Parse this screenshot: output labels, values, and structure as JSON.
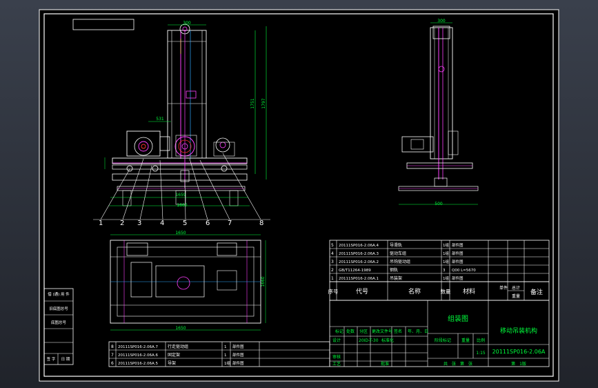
{
  "drawing": {
    "dims": {
      "top_width": "300",
      "height_total": "1751",
      "height_outer": "1797",
      "motor_offset": "531",
      "width_front": "1659",
      "base_width": "1660",
      "side_top": "300",
      "side_base": "500",
      "plan_width": "1650",
      "plan_depth": "1660",
      "plan_bottom": "1650"
    },
    "balloons": [
      "1",
      "2",
      "3",
      "4",
      "5",
      "6",
      "7",
      "8"
    ],
    "parts_upper": [
      {
        "no": "5",
        "code": "20111SP016-2.06A.4",
        "name": "导滑轨",
        "qty": "1组",
        "mat": "部件图"
      },
      {
        "no": "4",
        "code": "20111SP016-2.06A.3",
        "name": "驱动车组",
        "qty": "1组",
        "mat": "部件图"
      },
      {
        "no": "3",
        "code": "20111SP016-2.06A.2",
        "name": "吊钩驱动组",
        "qty": "1组",
        "mat": "部件图"
      },
      {
        "no": "2",
        "code": "GB/T11264-1989",
        "name": "钢轨",
        "qty": "3",
        "mat": "Q00 L=5670"
      },
      {
        "no": "1",
        "code": "20111SP016-2.06A.1",
        "name": "吊装架",
        "qty": "1组",
        "mat": "部件图"
      }
    ],
    "parts_lower": [
      {
        "no": "8",
        "code": "20111SP016-2.06A.7",
        "name": "行走驱动组",
        "qty": "1",
        "mat": "部件图"
      },
      {
        "no": "7",
        "code": "20111SP016-2.06A.6",
        "name": "固定架",
        "qty": "1",
        "mat": "部件图"
      },
      {
        "no": "6",
        "code": "20111SP016-2.06A.5",
        "name": "导架",
        "qty": "1组",
        "mat": "部件图"
      }
    ],
    "header_row": {
      "no": "序号",
      "code": "代号",
      "name": "名称",
      "qty": "数量",
      "mat": "材料",
      "unit_w": "单件",
      "total_w": "总计",
      "weight": "重量",
      "remark": "备注"
    },
    "title_block": {
      "assembly": "组装图",
      "title": "移动吊装机构",
      "drawing_no": "20111SP016-2.06A",
      "scale": "1:15",
      "mark": "标记",
      "count": "处数",
      "zone": "分区",
      "change_doc": "更改文件号",
      "sign": "签名",
      "date": "年、月、日",
      "design": "设计",
      "std": "标准化",
      "stage_mark": "阶段标记",
      "weight_lbl": "重量",
      "ratio_lbl": "比例",
      "review": "审核",
      "process": "工艺",
      "approve": "批准",
      "std_no": "20ID-T-30",
      "sheets": "共　张　第　张",
      "version": "第　1版"
    },
    "side_labels": [
      "借 (通) 用 件",
      "旧底图总号",
      "底图总号",
      "签 字",
      "日 期"
    ]
  }
}
